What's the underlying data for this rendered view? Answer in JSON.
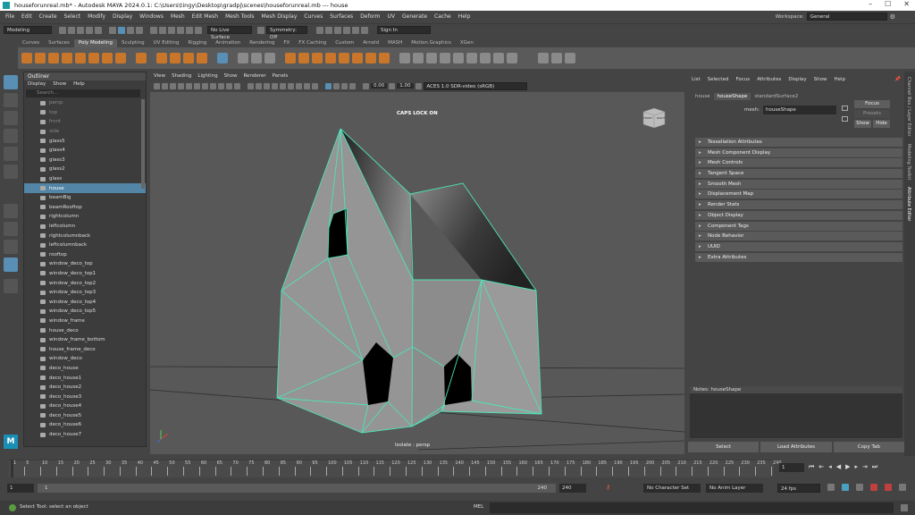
{
  "window": {
    "title": "houseforunreal.mb* - Autodesk MAYA 2024.0.1: C:\\Users\\tingy\\Desktop\\gradpj\\scenes\\houseforunreal.mb  ---  house"
  },
  "menubar": {
    "items": [
      "File",
      "Edit",
      "Create",
      "Select",
      "Modify",
      "Display",
      "Windows",
      "Mesh",
      "Edit Mesh",
      "Mesh Tools",
      "Mesh Display",
      "Curves",
      "Surfaces",
      "Deform",
      "UV",
      "Generate",
      "Cache",
      "Help"
    ],
    "workspace_label": "Workspace:",
    "workspace_value": "General"
  },
  "statusline": {
    "mode": "Modeling",
    "live_surface": "No Live Surface",
    "symmetry": "Symmetry: Off",
    "sign_in": "Sign In"
  },
  "shelf": {
    "tabs": [
      "Curves",
      "Surfaces",
      "Poly Modeling",
      "Sculpting",
      "UV Editing",
      "Rigging",
      "Animation",
      "Rendering",
      "FX",
      "FX Caching",
      "Custom",
      "Arnold",
      "MASH",
      "Motion Graphics",
      "XGen"
    ],
    "active_tab": "Poly Modeling"
  },
  "outliner": {
    "title": "Outliner",
    "menu": [
      "Display",
      "Show",
      "Help"
    ],
    "search_placeholder": "Search...",
    "items": [
      {
        "name": "persp",
        "dim": true
      },
      {
        "name": "top",
        "dim": true
      },
      {
        "name": "front",
        "dim": true
      },
      {
        "name": "side",
        "dim": true
      },
      {
        "name": "glass5"
      },
      {
        "name": "glass4"
      },
      {
        "name": "glass3"
      },
      {
        "name": "glass2"
      },
      {
        "name": "glass"
      },
      {
        "name": "house",
        "selected": true
      },
      {
        "name": "beamBig"
      },
      {
        "name": "beamRooftop"
      },
      {
        "name": "rightcolumn"
      },
      {
        "name": "leftcolumn"
      },
      {
        "name": "rightcolumnback"
      },
      {
        "name": "leftcolumnback"
      },
      {
        "name": "rooftop"
      },
      {
        "name": "window_deco_top"
      },
      {
        "name": "window_deco_top1"
      },
      {
        "name": "window_deco_top2"
      },
      {
        "name": "window_deco_top3"
      },
      {
        "name": "window_deco_top4"
      },
      {
        "name": "window_deco_top5"
      },
      {
        "name": "window_frame"
      },
      {
        "name": "house_deco"
      },
      {
        "name": "window_frame_bottom"
      },
      {
        "name": "house_frame_deco"
      },
      {
        "name": "window_deco"
      },
      {
        "name": "deco_house"
      },
      {
        "name": "deco_house1"
      },
      {
        "name": "deco_house2"
      },
      {
        "name": "deco_house3"
      },
      {
        "name": "deco_house4"
      },
      {
        "name": "deco_house5"
      },
      {
        "name": "deco_house6"
      },
      {
        "name": "deco_house7"
      }
    ]
  },
  "viewport": {
    "menu": [
      "View",
      "Shading",
      "Lighting",
      "Show",
      "Renderer",
      "Panels"
    ],
    "exposure": "0.00",
    "gamma": "1.00",
    "color_space": "ACES 1.0 SDR-video (sRGB)",
    "caps_lock": "CAPS LOCK ON",
    "camera_label": "Isolate : persp",
    "viewcube_front": "FRONT",
    "viewcube_right": "RIGHT"
  },
  "attribute_editor": {
    "menu": [
      "List",
      "Selected",
      "Focus",
      "Attributes",
      "Display",
      "Show",
      "Help"
    ],
    "tabs": [
      "house",
      "houseShape",
      "standardSurface2"
    ],
    "active_tab": "houseShape",
    "mesh_label": "mesh:",
    "mesh_value": "houseShape",
    "focus_btn": "Focus",
    "presets_btn": "Presets",
    "show_btn": "Show",
    "hide_btn": "Hide",
    "sections": [
      "Tessellation Attributes",
      "Mesh Component Display",
      "Mesh Controls",
      "Tangent Space",
      "Smooth Mesh",
      "Displacement Map",
      "Render Stats",
      "Object Display",
      "Component Tags",
      "Node Behavior",
      "UUID",
      "Extra Attributes"
    ],
    "notes_label": "Notes:  houseShape",
    "select_btn": "Select",
    "load_btn": "Load Attributes",
    "copy_btn": "Copy Tab"
  },
  "side_tabs": [
    "Channel Box / Layer Editor",
    "Modeling Toolkit",
    "Attribute Editor"
  ],
  "timeline": {
    "ticks": [
      "1",
      "5",
      "10",
      "15",
      "20",
      "25",
      "30",
      "35",
      "40",
      "45",
      "50",
      "55",
      "60",
      "65",
      "70",
      "75",
      "80",
      "85",
      "90",
      "95",
      "100",
      "105",
      "110",
      "115",
      "120",
      "125",
      "130",
      "135",
      "140",
      "145",
      "150",
      "155",
      "160",
      "165",
      "170",
      "175",
      "180",
      "185",
      "190",
      "195",
      "200",
      "205",
      "210",
      "215",
      "220",
      "225",
      "230",
      "235",
      "240"
    ],
    "current_frame": "1"
  },
  "range": {
    "start": "1",
    "start_inner": "1",
    "end_inner": "240",
    "end": "240",
    "range_end": "240",
    "character_set": "No Character Set",
    "anim_layer": "No Anim Layer",
    "fps": "24 fps"
  },
  "cmdline": {
    "status": "Select Tool: select an object",
    "lang": "MEL"
  }
}
